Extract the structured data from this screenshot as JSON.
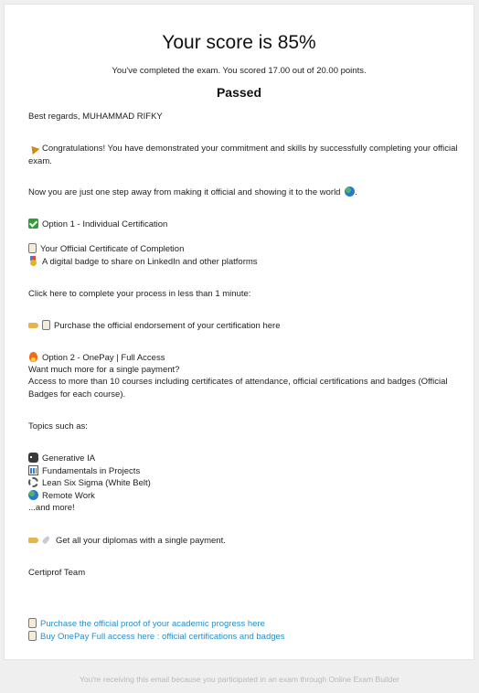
{
  "header": {
    "title": "Your score is 85%",
    "subtitle": "You've completed the exam. You scored 17.00 out of 20.00 points.",
    "status": "Passed"
  },
  "body": {
    "greeting": "Best regards, MUHAMMAD RIFKY",
    "congrats": "Congratulations! You have demonstrated your commitment and skills by successfully completing your official exam.",
    "one_step": "Now you are just one step away from making it official and showing it to the world",
    "option1_title": "Option 1 - Individual Certification",
    "option1_item1": "Your Official Certificate of Completion",
    "option1_item2": "A digital badge to share on LinkedIn and other platforms",
    "click_here": "Click here to complete your process in less than 1 minute:",
    "purchase_endorsement": "Purchase the official endorsement of your certification here",
    "option2_title": "Option 2 - OnePay | Full Access",
    "option2_line1": "Want much more for a single payment?",
    "option2_line2": "Access to more than 10 courses including certificates of attendance, official certifications and badges (Official Badges for each course).",
    "topics_intro": "Topics such as:",
    "topics": [
      "Generative IA",
      "Fundamentals in Projects",
      "Lean Six Sigma (White Belt)",
      "Remote Work"
    ],
    "and_more": "...and more!",
    "diplomas": "Get all your diplomas with a single payment.",
    "signature": "Certiprof Team",
    "link1": "Purchase the official proof of your academic progress here",
    "link2": "Buy OnePay Full access here : official certifications and badges"
  },
  "footer": {
    "text": "You're receiving this email because you participated in an exam through Online Exam Builder"
  },
  "colors": {
    "link": "#2a8ec7",
    "background": "#efefef",
    "card": "#ffffff"
  }
}
